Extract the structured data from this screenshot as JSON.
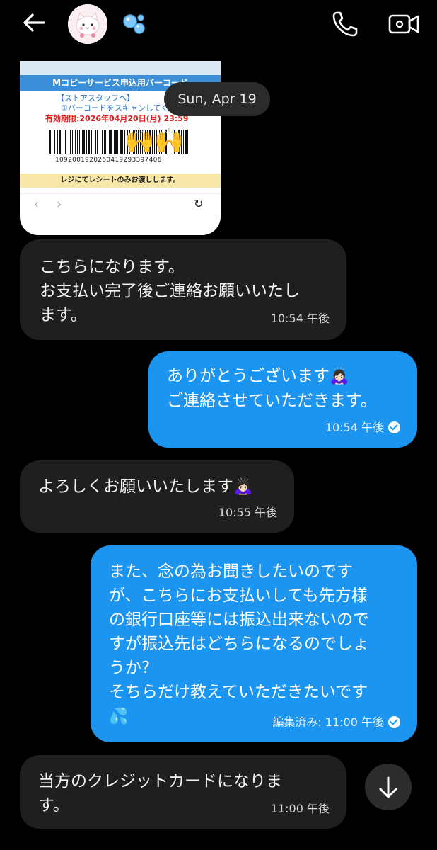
{
  "header": {
    "back_icon": "arrow-left-icon",
    "avatar_icon": "cat-avatar",
    "bubbles_icon": "soap-bubbles-icon",
    "call_icon": "phone-icon",
    "video_icon": "video-camera-icon"
  },
  "date_separator": "Sun, Apr 19",
  "screenshot_message": {
    "title": "Mコピーサービス申込用バーコード",
    "staff_label": "【ストアスタッフへ】",
    "scan_instruction": "①バーコードをスキャンしてくださ",
    "expiry": "有効期限:2026年04月20日(月) 23:59",
    "barcode_number": "1092001920260419293397406",
    "receipt_note": "レジにてレシートのみお渡しします。",
    "nav_prev": "‹",
    "nav_next": "›",
    "reload": "↻",
    "overlay_emoji": "🙌🙌"
  },
  "messages": [
    {
      "direction": "incoming",
      "lines": [
        "こちらになります。",
        "お支払い完了後ご連絡お願いいたし",
        "ます。"
      ],
      "time": "10:54 午後"
    },
    {
      "direction": "outgoing",
      "lines": [
        "ありがとうございます",
        "ご連絡させていただきます。"
      ],
      "emoji": "🙇🏻‍♀️",
      "time": "10:54 午後"
    },
    {
      "direction": "incoming",
      "lines": [
        "よろしくお願いいたします"
      ],
      "emoji": "🙇🏻‍♀️",
      "time": "10:55 午後"
    },
    {
      "direction": "outgoing",
      "lines": [
        "また、念の為お聞きしたいのです",
        "が、こちらにお支払いしても先方様",
        "の銀行口座等には振込出来ないので",
        "すが振込先はどちらになるのでしょ",
        "うか?",
        "そちらだけ教えていただきたいです"
      ],
      "emoji": "💦",
      "time": "編集済み: 11:00 午後"
    },
    {
      "direction": "incoming",
      "lines": [
        "当方のクレジットカードになりま",
        "す。"
      ],
      "time": "11:00 午後"
    }
  ],
  "scroll_button_icon": "arrow-down-icon",
  "colors": {
    "background": "#000000",
    "incoming_bubble": "#1f1f1f",
    "outgoing_bubble": "#1c95f0",
    "date_pill": "#2b2b2b"
  }
}
